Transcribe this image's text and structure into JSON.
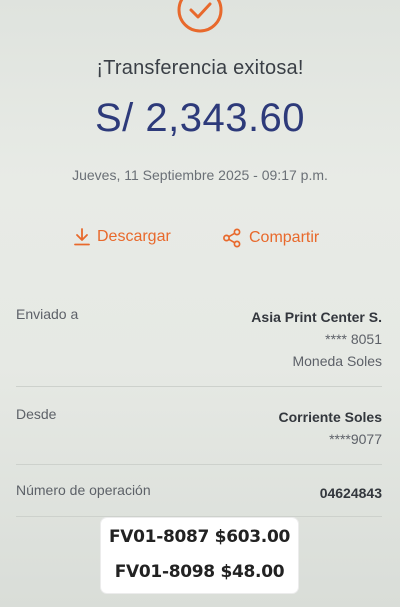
{
  "header": {
    "title": "¡Transferencia exitosa!",
    "amount": "S/ 2,343.60",
    "date": "Jueves, 11 Septiembre 2025 - 09:17 p.m.",
    "icon": "check-circle-icon"
  },
  "actions": {
    "download_label": "Descargar",
    "share_label": "Compartir"
  },
  "details": {
    "sent_to": {
      "label": "Enviado a",
      "name": "Asia Print Center S.",
      "account": "**** 8051",
      "currency": "Moneda Soles"
    },
    "from": {
      "label": "Desde",
      "name": "Corriente Soles",
      "account": "****9077"
    },
    "operation": {
      "label": "Número de operación",
      "number": "04624843"
    }
  },
  "overlay_note": {
    "line1": "FV01-8087 $603.00",
    "line2": "FV01-8098 $48.00"
  },
  "colors": {
    "accent": "#e8692c",
    "amount": "#2d3a7a",
    "background": "#e6e9e4"
  }
}
